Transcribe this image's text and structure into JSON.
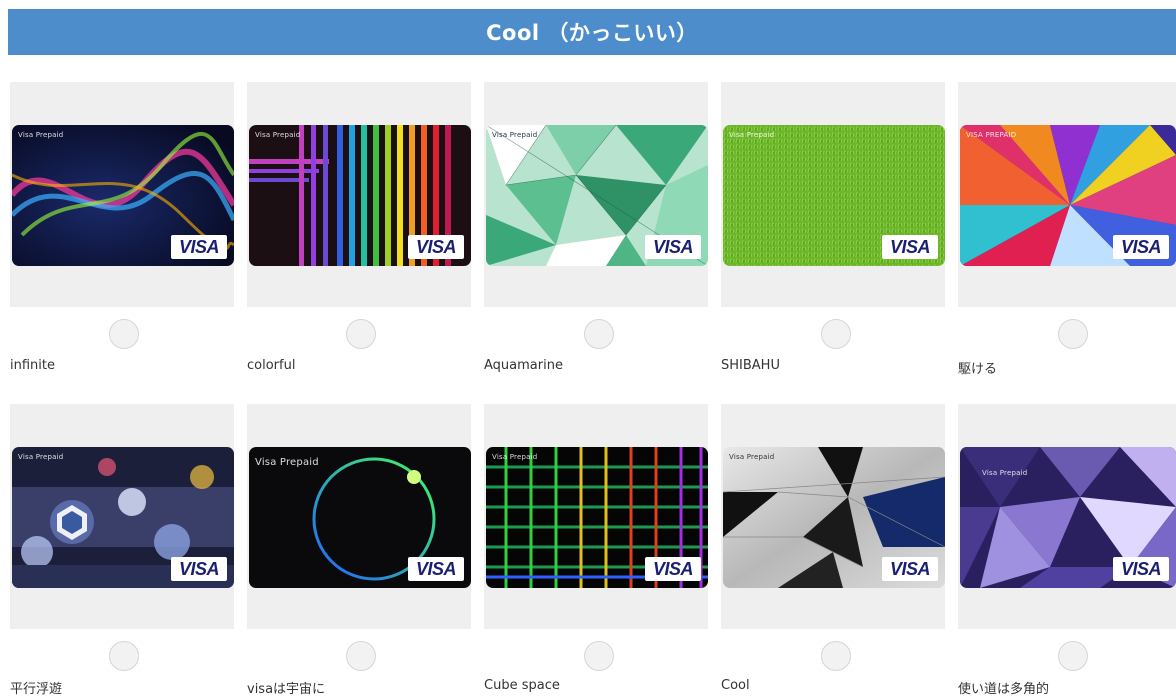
{
  "section": {
    "title": "Cool （かっこいい）"
  },
  "designs": [
    {
      "label": "infinite",
      "brand_text": "Visa Prepaid",
      "network": "VISA"
    },
    {
      "label": "colorful",
      "brand_text": "Visa Prepaid",
      "network": "VISA"
    },
    {
      "label": "Aquamarine",
      "brand_text": "Visa Prepaid",
      "network": "VISA"
    },
    {
      "label": "SHIBAHU",
      "brand_text": "Visa Prepaid",
      "network": "VISA"
    },
    {
      "label": "駆ける",
      "brand_text": "VISA PREPAID",
      "network": "VISA"
    },
    {
      "label": "平行浮遊",
      "brand_text": "Visa Prepaid",
      "network": "VISA"
    },
    {
      "label": "visaは宇宙に",
      "brand_text": "Visa Prepaid",
      "network": "VISA"
    },
    {
      "label": "Cube space",
      "brand_text": "Visa Prepaid",
      "network": "VISA"
    },
    {
      "label": "Cool",
      "brand_text": "Visa Prepaid",
      "network": "VISA"
    },
    {
      "label": "使い道は多角的",
      "brand_text": "Visa Prepaid",
      "network": "VISA"
    }
  ],
  "colors": {
    "banner": "#4d8dcc",
    "tile": "#efefef",
    "visa_blue": "#1a1f71"
  }
}
